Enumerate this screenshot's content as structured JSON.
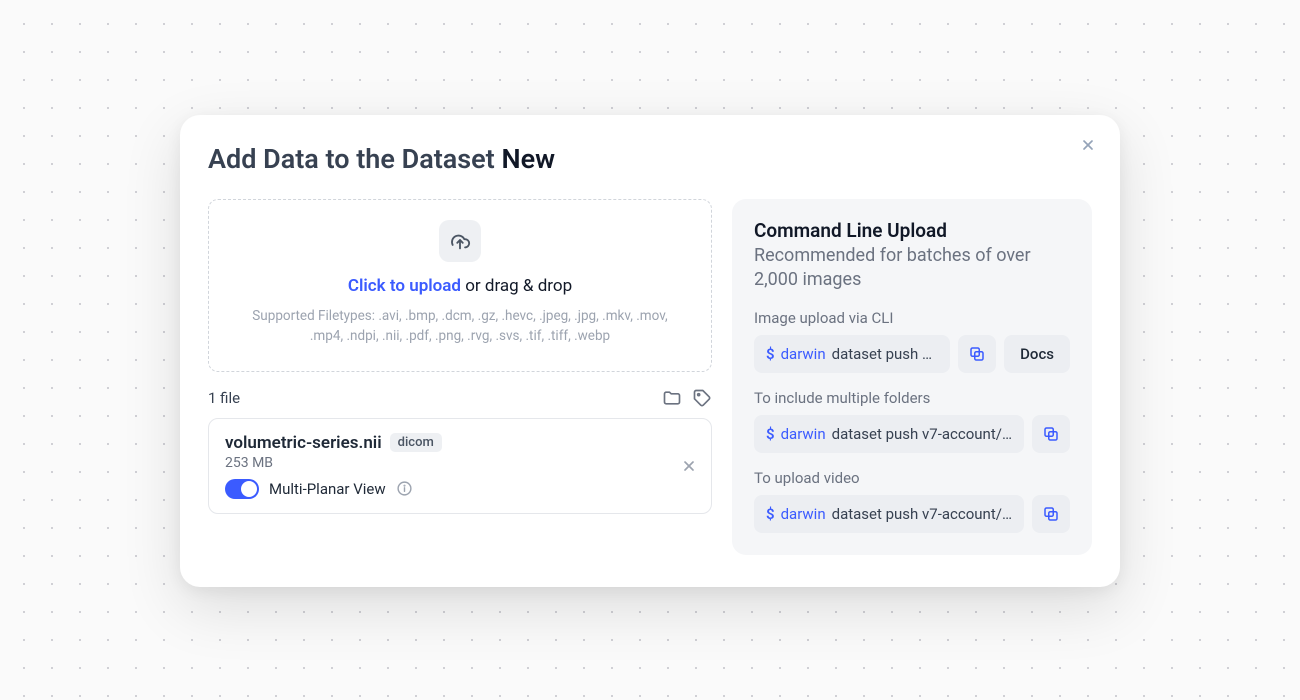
{
  "modal": {
    "title_prefix": "Add Data to the Dataset ",
    "dataset_name": "New"
  },
  "dropzone": {
    "click_label": "Click to upload",
    "drag_label": " or drag & drop",
    "filetypes": "Supported Filetypes: .avi, .bmp, .dcm, .gz, .hevc, .jpeg, .jpg, .mkv, .mov, .mp4, .ndpi, .nii, .pdf, .png, .rvg, .svs, .tif, .tiff, .webp"
  },
  "files": {
    "count_label": "1 file",
    "items": [
      {
        "name": "volumetric-series.nii",
        "badge": "dicom",
        "size": "253 MB",
        "mpv_label": "Multi-Planar View",
        "mpv_on": true
      }
    ]
  },
  "cli": {
    "title": "Command Line Upload",
    "subtitle": "Recommended for batches of over 2,000 images",
    "docs_label": "Docs",
    "sections": [
      {
        "label": "Image upload via CLI",
        "prompt": "$",
        "bin": "darwin",
        "rest": "dataset push v…",
        "has_docs": true
      },
      {
        "label": "To include multiple folders",
        "prompt": "$",
        "bin": "darwin",
        "rest": "dataset push v7-account/n…",
        "has_docs": false
      },
      {
        "label": "To upload video",
        "prompt": "$",
        "bin": "darwin",
        "rest": "dataset push v7-account/n…",
        "has_docs": false
      }
    ]
  }
}
